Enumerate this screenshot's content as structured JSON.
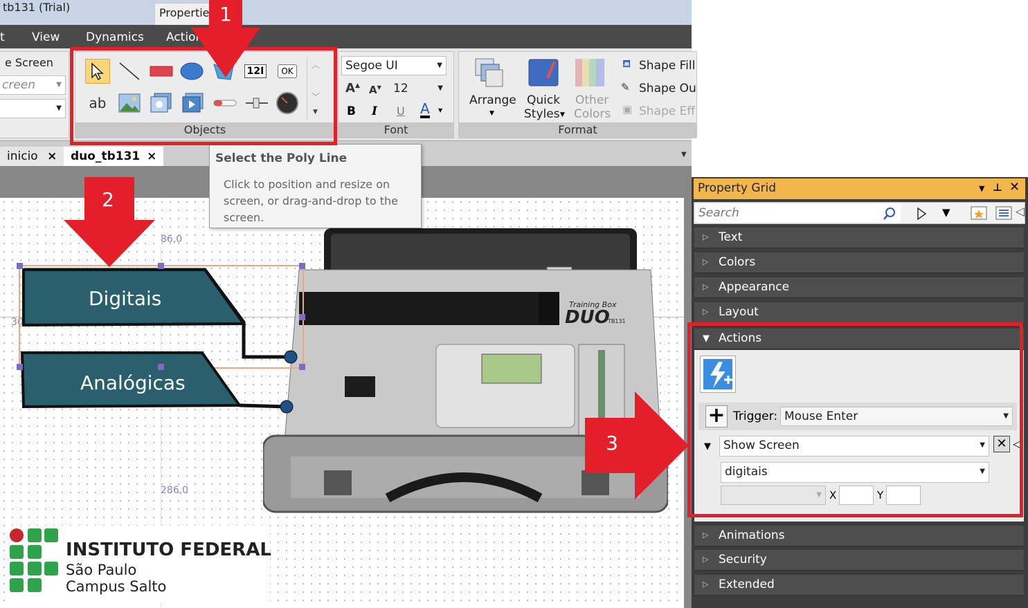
{
  "app": {
    "title": "tb131 (Trial)",
    "context_tab": "Properties"
  },
  "menu": [
    "t",
    "View",
    "Dynamics",
    "Actions"
  ],
  "ribbon": {
    "left_group": {
      "item1": "e Screen",
      "item2": "creen"
    },
    "objects_label": "Objects",
    "objects_row1": [
      "select-arrow-icon",
      "line-icon",
      "rectangle-icon",
      "ellipse-icon",
      "polyline-icon",
      "numeric-text-icon",
      "ok-button-icon"
    ],
    "objects_row1_text": {
      "numeric": "12I",
      "ok": "OK"
    },
    "objects_row2": [
      "text-icon",
      "image-icon",
      "sprite-icon",
      "video-icon",
      "slider-control-icon",
      "switch-icon",
      "gauge-icon"
    ],
    "objects_row2_text": {
      "text": "ab"
    },
    "font_label": "Font",
    "font_name": "Segoe UI",
    "font_size": "12",
    "font_buttons": {
      "bold": "B",
      "italic": "I",
      "underline": "U",
      "color": "A"
    },
    "format_label": "Format",
    "arrange": "Arrange",
    "quick_styles_1": "Quick",
    "quick_styles_2": "Styles",
    "other_colors_1": "Other",
    "other_colors_2": "Colors",
    "shape_fill": "Shape Fill",
    "shape_outline": "Shape Ou",
    "shape_effects": "Shape Eff"
  },
  "tabs": [
    {
      "label": "inicio"
    },
    {
      "label": "duo_tb131"
    }
  ],
  "tab_close": "×",
  "tooltip": {
    "title": "Select the Poly Line",
    "body": "Click to position and resize on screen, or drag-and-drop to the screen."
  },
  "canvas": {
    "coord1": "86,0",
    "coord2": "30",
    "coord3": "286,0",
    "button1": "Digitais",
    "button2": "Analógicas",
    "device_brand": "DUO",
    "device_model": "TB131",
    "device_label": "Training Box"
  },
  "logo": {
    "line1": "INSTITUTO FEDERAL",
    "line2": "São Paulo",
    "line3": "Campus Salto"
  },
  "property_grid": {
    "title": "Property Grid",
    "search_placeholder": "Search",
    "categories_top": [
      "Text",
      "Colors",
      "Appearance",
      "Layout"
    ],
    "actions_label": "Actions",
    "trigger_label": "Trigger:",
    "trigger_value": "Mouse Enter",
    "action_value": "Show Screen",
    "screen_value": "digitais",
    "x_label": "X",
    "y_label": "Y",
    "categories_bottom": [
      "Animations",
      "Security",
      "Extended"
    ]
  },
  "annotations": {
    "badge1": "1",
    "badge2": "2",
    "badge3": "3"
  },
  "colors": {
    "highlight": "#e51f29",
    "button_fill": "#2a5f6d",
    "pg_header": "#f3b64a"
  }
}
